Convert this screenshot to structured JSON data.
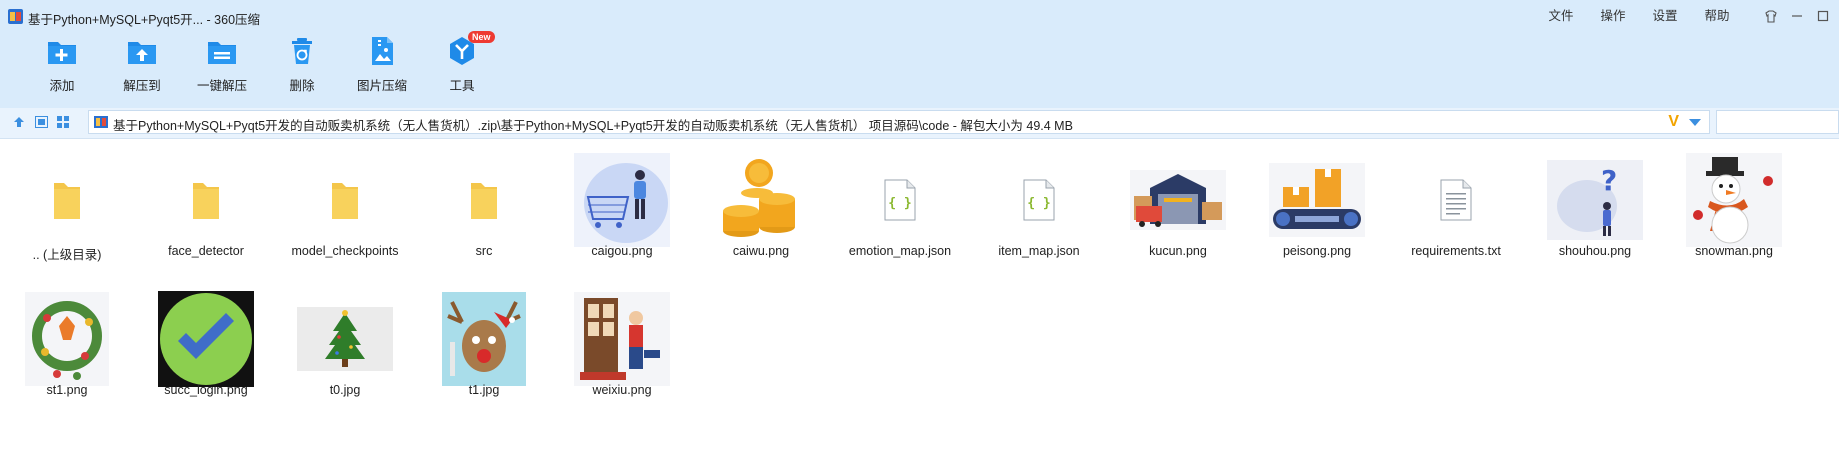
{
  "window": {
    "title": "基于Python+MySQL+Pyqt5开... - 360压缩",
    "menu": [
      "文件",
      "操作",
      "设置",
      "帮助"
    ]
  },
  "toolbar": {
    "buttons": [
      {
        "label": "添加",
        "icon": "add-icon"
      },
      {
        "label": "解压到",
        "icon": "extract-to-icon"
      },
      {
        "label": "一键解压",
        "icon": "one-click-extract-icon"
      },
      {
        "label": "删除",
        "icon": "delete-icon"
      },
      {
        "label": "图片压缩",
        "icon": "image-compress-icon"
      },
      {
        "label": "工具",
        "icon": "tools-icon",
        "badge": "New"
      }
    ]
  },
  "address": {
    "path": "基于Python+MySQL+Pyqt5开发的自动贩卖机系统（无人售货机）.zip\\基于Python+MySQL+Pyqt5开发的自动贩卖机系统（无人售货机） 项目源码\\code - 解包大小为 49.4 MB"
  },
  "files": [
    {
      "name": ".. (上级目录)",
      "type": "folder"
    },
    {
      "name": "face_detector",
      "type": "folder"
    },
    {
      "name": "model_checkpoints",
      "type": "folder"
    },
    {
      "name": "src",
      "type": "folder"
    },
    {
      "name": "caigou.png",
      "type": "image"
    },
    {
      "name": "caiwu.png",
      "type": "image"
    },
    {
      "name": "emotion_map.json",
      "type": "json"
    },
    {
      "name": "item_map.json",
      "type": "json"
    },
    {
      "name": "kucun.png",
      "type": "image"
    },
    {
      "name": "peisong.png",
      "type": "image"
    },
    {
      "name": "requirements.txt",
      "type": "text"
    },
    {
      "name": "shouhou.png",
      "type": "image"
    },
    {
      "name": "snowman.png",
      "type": "image"
    },
    {
      "name": "st1.png",
      "type": "image"
    },
    {
      "name": "succ_login.png",
      "type": "image"
    },
    {
      "name": "t0.jpg",
      "type": "image"
    },
    {
      "name": "t1.jpg",
      "type": "image"
    },
    {
      "name": "weixiu.png",
      "type": "image"
    }
  ],
  "colors": {
    "chrome_bg": "#d9ebfb",
    "accent_blue": "#1f8ae8",
    "badge_red": "#ee3a32",
    "folder_yellow": "#f8d25c"
  }
}
